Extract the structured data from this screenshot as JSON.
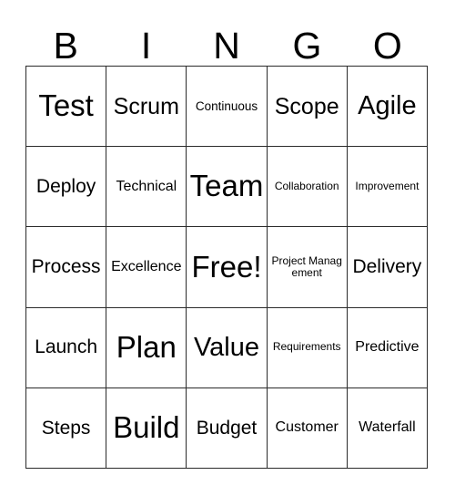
{
  "card": {
    "header_letters": [
      "B",
      "I",
      "N",
      "G",
      "O"
    ],
    "free_space_label": "Free!",
    "grid": [
      [
        {
          "text": "Test",
          "size": "xxl"
        },
        {
          "text": "Scrum",
          "size": "lg"
        },
        {
          "text": "Continuous",
          "size": "xs"
        },
        {
          "text": "Scope",
          "size": "lg"
        },
        {
          "text": "Agile",
          "size": "xl"
        }
      ],
      [
        {
          "text": "Deploy",
          "size": "md"
        },
        {
          "text": "Technical",
          "size": "sm"
        },
        {
          "text": "Team",
          "size": "xxl"
        },
        {
          "text": "Collaboration",
          "size": "xxs"
        },
        {
          "text": "Improvement",
          "size": "xxs"
        }
      ],
      [
        {
          "text": "Process",
          "size": "md"
        },
        {
          "text": "Excellence",
          "size": "sm"
        },
        {
          "text": "Free!",
          "size": "xxl"
        },
        {
          "text": "Project Management",
          "size": "xxs"
        },
        {
          "text": "Delivery",
          "size": "md"
        }
      ],
      [
        {
          "text": "Launch",
          "size": "md"
        },
        {
          "text": "Plan",
          "size": "xxl"
        },
        {
          "text": "Value",
          "size": "xl"
        },
        {
          "text": "Requirements",
          "size": "xxs"
        },
        {
          "text": "Predictive",
          "size": "sm"
        }
      ],
      [
        {
          "text": "Steps",
          "size": "md"
        },
        {
          "text": "Build",
          "size": "xxl"
        },
        {
          "text": "Budget",
          "size": "md"
        },
        {
          "text": "Customer",
          "size": "sm"
        },
        {
          "text": "Waterfall",
          "size": "sm"
        }
      ]
    ]
  },
  "colors": {
    "background": "#ffffff",
    "text": "#000000",
    "grid_line": "#2b2b2b"
  }
}
